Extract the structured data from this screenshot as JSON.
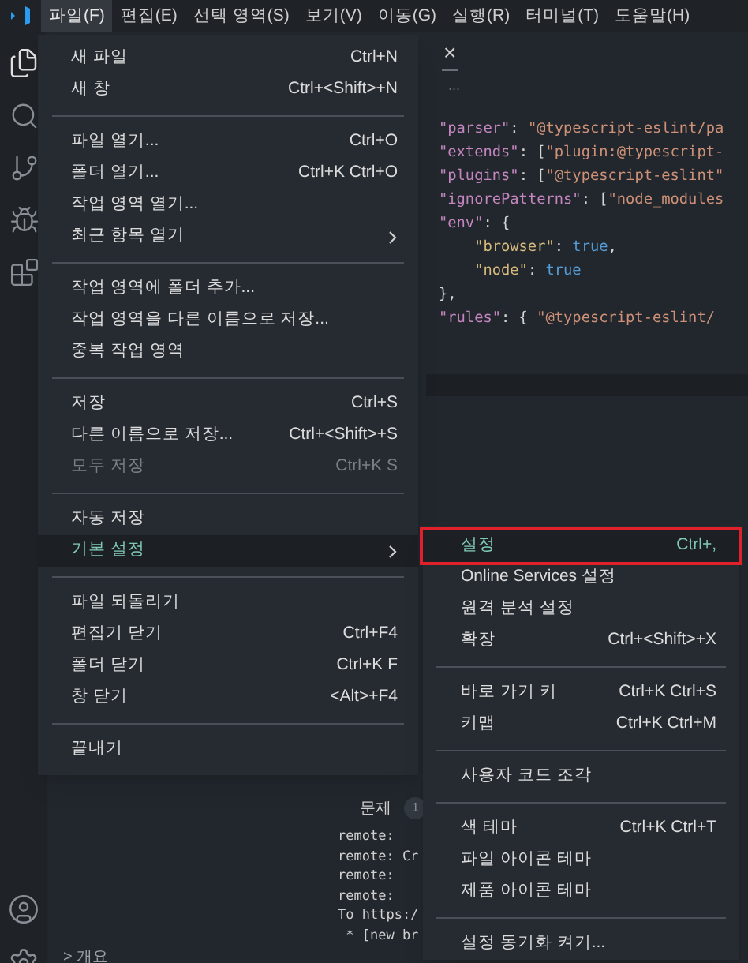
{
  "menu_bar": [
    {
      "label": "파일(F)",
      "selected": true
    },
    {
      "label": "편집(E)",
      "selected": false
    },
    {
      "label": "선택 영역(S)",
      "selected": false
    },
    {
      "label": "보기(V)",
      "selected": false
    },
    {
      "label": "이동(G)",
      "selected": false
    },
    {
      "label": "실행(R)",
      "selected": false
    },
    {
      "label": "터미널(T)",
      "selected": false
    },
    {
      "label": "도움말(H)",
      "selected": false
    }
  ],
  "editor": {
    "tab_close": "×",
    "breadcrumb": "...",
    "code_lines": [
      [
        {
          "kind": "key",
          "text": "\"parser\""
        },
        {
          "kind": "punct",
          "text": ": "
        },
        {
          "kind": "string",
          "text": "\"@typescript-eslint/pa"
        }
      ],
      [
        {
          "kind": "key",
          "text": "\"extends\""
        },
        {
          "kind": "punct",
          "text": ": ["
        },
        {
          "kind": "string",
          "text": "\"plugin:@typescript-"
        }
      ],
      [
        {
          "kind": "key",
          "text": "\"plugins\""
        },
        {
          "kind": "punct",
          "text": ": ["
        },
        {
          "kind": "string",
          "text": "\"@typescript-eslint\""
        }
      ],
      [
        {
          "kind": "key",
          "text": "\"ignorePatterns\""
        },
        {
          "kind": "punct",
          "text": ": ["
        },
        {
          "kind": "string",
          "text": "\"node_modules"
        }
      ],
      [
        {
          "kind": "key",
          "text": "\"env\""
        },
        {
          "kind": "punct",
          "text": ": {"
        }
      ],
      [
        {
          "kind": "subkey",
          "text": "\"browser\""
        },
        {
          "kind": "punct",
          "text": ": "
        },
        {
          "kind": "literal",
          "text": "true"
        },
        {
          "kind": "punct",
          "text": ","
        }
      ],
      [
        {
          "kind": "subkey",
          "text": "\"node\""
        },
        {
          "kind": "punct",
          "text": ": "
        },
        {
          "kind": "literal",
          "text": "true"
        }
      ],
      [
        {
          "kind": "punct",
          "text": "},"
        }
      ],
      [
        {
          "kind": "key",
          "text": "\"rules\""
        },
        {
          "kind": "punct",
          "text": ": { "
        },
        {
          "kind": "string",
          "text": "\"@typescript-eslint/"
        }
      ]
    ]
  },
  "file_menu": {
    "groups": [
      [
        {
          "label": "새 파일",
          "shortcut": "Ctrl+N",
          "disabled": false,
          "selected": false,
          "submenu": false
        },
        {
          "label": "새 창",
          "shortcut": "Ctrl+<Shift>+N",
          "disabled": false,
          "selected": false,
          "submenu": false
        }
      ],
      [
        {
          "label": "파일 열기...",
          "shortcut": "Ctrl+O",
          "disabled": false,
          "selected": false,
          "submenu": false
        },
        {
          "label": "폴더 열기...",
          "shortcut": "Ctrl+K Ctrl+O",
          "disabled": false,
          "selected": false,
          "submenu": false
        },
        {
          "label": "작업 영역 열기...",
          "disabled": false,
          "selected": false,
          "submenu": false
        },
        {
          "label": "최근 항목 열기",
          "disabled": false,
          "selected": false,
          "submenu": true
        }
      ],
      [
        {
          "label": "작업 영역에 폴더 추가...",
          "disabled": false,
          "selected": false,
          "submenu": false
        },
        {
          "label": "작업 영역을 다른 이름으로 저장...",
          "disabled": false,
          "selected": false,
          "submenu": false
        },
        {
          "label": "중복 작업 영역",
          "disabled": false,
          "selected": false,
          "submenu": false
        }
      ],
      [
        {
          "label": "저장",
          "shortcut": "Ctrl+S",
          "disabled": false,
          "selected": false,
          "submenu": false
        },
        {
          "label": "다른 이름으로 저장...",
          "shortcut": "Ctrl+<Shift>+S",
          "disabled": false,
          "selected": false,
          "submenu": false
        },
        {
          "label": "모두 저장",
          "shortcut": "Ctrl+K S",
          "disabled": true,
          "selected": false,
          "submenu": false
        }
      ],
      [
        {
          "label": "자동 저장",
          "disabled": false,
          "selected": false,
          "submenu": false
        },
        {
          "label": "기본 설정",
          "disabled": false,
          "selected": true,
          "submenu": true
        }
      ],
      [
        {
          "label": "파일 되돌리기",
          "disabled": false,
          "selected": false,
          "submenu": false
        },
        {
          "label": "편집기 닫기",
          "shortcut": "Ctrl+F4",
          "disabled": false,
          "selected": false,
          "submenu": false
        },
        {
          "label": "폴더 닫기",
          "shortcut": "Ctrl+K F",
          "disabled": false,
          "selected": false,
          "submenu": false
        },
        {
          "label": "창 닫기",
          "shortcut": "<Alt>+F4",
          "disabled": false,
          "selected": false,
          "submenu": false
        }
      ],
      [
        {
          "label": "끝내기",
          "disabled": false,
          "selected": false,
          "submenu": false
        }
      ]
    ]
  },
  "preferences_submenu": {
    "groups": [
      [
        {
          "label": "설정",
          "shortcut": "Ctrl+,",
          "selected": true,
          "outlined": true
        },
        {
          "label": "Online Services 설정",
          "selected": false,
          "outlined": false
        },
        {
          "label": "원격 분석 설정",
          "selected": false,
          "outlined": false
        },
        {
          "label": "확장",
          "shortcut": "Ctrl+<Shift>+X",
          "selected": false,
          "outlined": false
        }
      ],
      [
        {
          "label": "바로 가기 키",
          "shortcut": "Ctrl+K Ctrl+S",
          "selected": false,
          "outlined": false
        },
        {
          "label": "키맵",
          "shortcut": "Ctrl+K Ctrl+M",
          "selected": false,
          "outlined": false
        }
      ],
      [
        {
          "label": "사용자 코드 조각",
          "selected": false,
          "outlined": false
        }
      ],
      [
        {
          "label": "색 테마",
          "shortcut": "Ctrl+K Ctrl+T",
          "selected": false,
          "outlined": false
        },
        {
          "label": "파일 아이콘 테마",
          "selected": false,
          "outlined": false
        },
        {
          "label": "제품 아이콘 테마",
          "selected": false,
          "outlined": false
        }
      ],
      [
        {
          "label": "설정 동기화 켜기...",
          "selected": false,
          "outlined": false
        }
      ]
    ]
  },
  "panel": {
    "tab": "문제",
    "badge": "1",
    "terminal_lines": [
      "remote:",
      "remote: Cr",
      "remote:",
      "remote:",
      "To https:/",
      " * [new br"
    ]
  },
  "sidebar_footer": {
    "section": "> 개요"
  }
}
